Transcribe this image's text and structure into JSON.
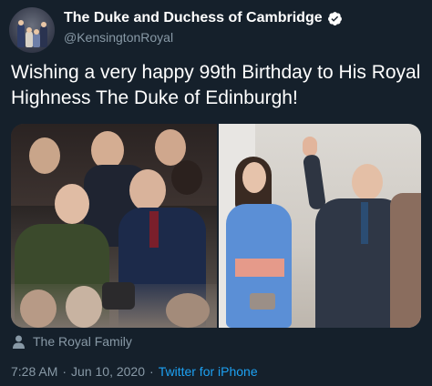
{
  "account": {
    "display_name": "The Duke and Duchess of Cambridge",
    "handle": "@KensingtonRoyal",
    "verified": true
  },
  "tweet": {
    "text": "Wishing a very happy 99th Birthday to His Royal Highness The Duke of Edinburgh!",
    "timestamp": "7:28 AM · Jun 10, 2020",
    "time": "7:28 AM",
    "date": "Jun 10, 2020",
    "separator": "·",
    "client": "Twitter for iPhone"
  },
  "attribution": {
    "icon": "person-icon",
    "label": "The Royal Family"
  },
  "colors": {
    "background": "#15202b",
    "secondary_text": "#8899a6",
    "link": "#1da1f2",
    "verified": "#ffffff"
  }
}
